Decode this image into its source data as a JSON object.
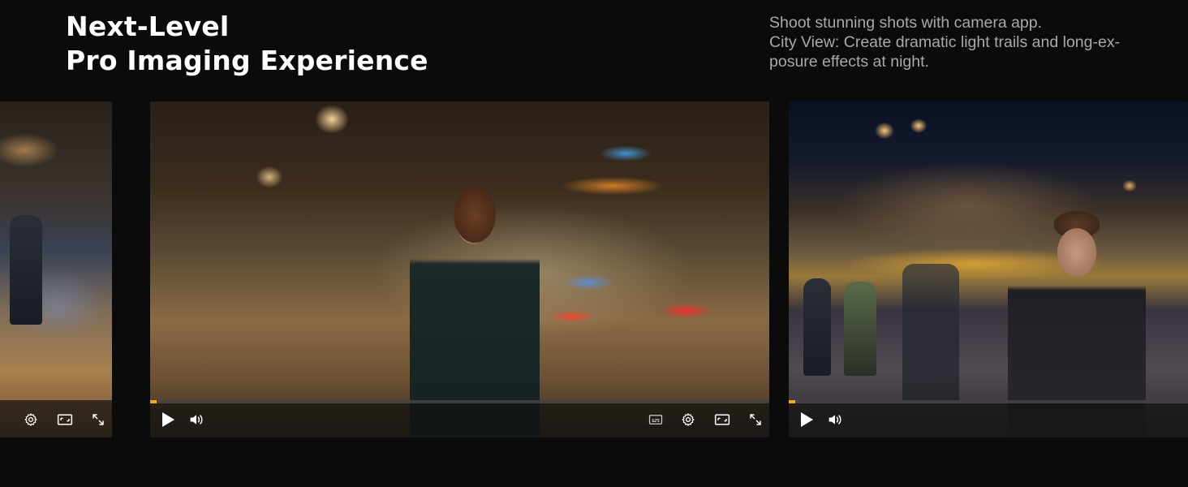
{
  "header": {
    "title_line1": "Next-Level",
    "title_line2": "Pro Imaging Experience",
    "description_line1": "Shoot stunning shots with camera app.",
    "description_line2": "City View: Create dramatic light trails and long-ex-",
    "description_line3": "posure effects at night."
  },
  "players": [
    {
      "name": "left",
      "controls": [
        "settings-icon",
        "aspect-ratio-icon",
        "fullscreen-icon"
      ]
    },
    {
      "name": "center",
      "progress": 0.01,
      "controls": [
        "play-icon",
        "volume-icon",
        "subtitles-icon",
        "settings-icon",
        "aspect-ratio-icon",
        "fullscreen-icon"
      ]
    },
    {
      "name": "right",
      "progress": 0.016,
      "controls": [
        "play-icon",
        "volume-icon"
      ]
    }
  ],
  "colors": {
    "background": "#0b0b0b",
    "accent": "#f5a623",
    "title": "#ffffff",
    "description": "#a9a9a9"
  }
}
